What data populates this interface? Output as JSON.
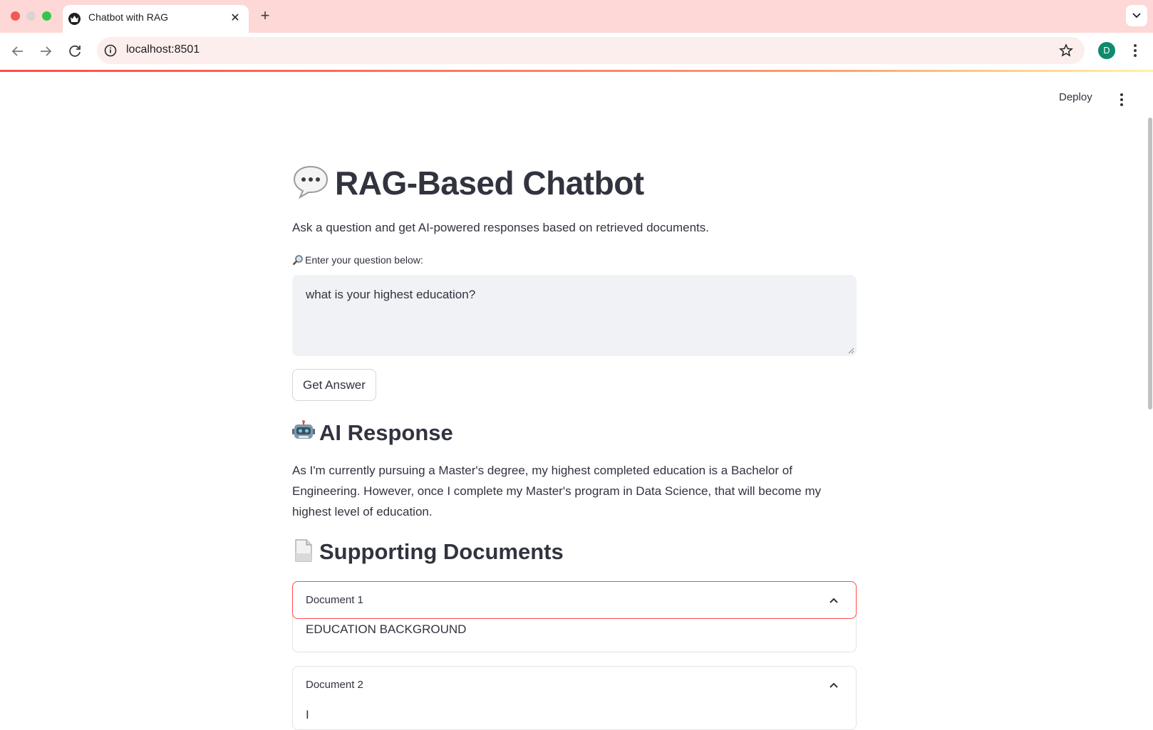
{
  "browser": {
    "tab_title": "Chatbot with RAG",
    "tab_close": "✕",
    "new_tab": "+",
    "url": "localhost:8501",
    "profile_initial": "D"
  },
  "header": {
    "deploy_label": "Deploy"
  },
  "main": {
    "title": "RAG-Based Chatbot",
    "subtitle": "Ask a question and get AI-powered responses based on retrieved documents.",
    "input_label": "Enter your question below:",
    "question_value": "what is your highest education?",
    "button_label": "Get Answer",
    "response_heading": "AI Response",
    "response_text": "As I'm currently pursuing a Master's degree, my highest completed education is a Bachelor of Engineering. However, once I complete my Master's program in Data Science, that will become my highest level of education.",
    "docs_heading": "Supporting Documents",
    "documents": [
      {
        "title": "Document 1",
        "content": "EDUCATION BACKGROUND"
      },
      {
        "title": "Document 2",
        "content": "I"
      }
    ]
  },
  "colors": {
    "accent": "#ff4b4b",
    "text": "#31333f",
    "input_bg": "#f0f2f6",
    "tabbar_bg": "#fdd8d6",
    "profile_bg": "#0f8a6c"
  }
}
